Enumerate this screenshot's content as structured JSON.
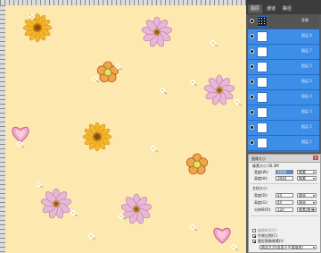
{
  "panel": {
    "tabs": [
      "图层",
      "通道",
      "路径"
    ],
    "layers": [
      {
        "name": "背景",
        "type": "background"
      },
      {
        "name": "图层 8"
      },
      {
        "name": "图层 7"
      },
      {
        "name": "图层 6"
      },
      {
        "name": "图层 5"
      },
      {
        "name": "图层 4"
      },
      {
        "name": "图层 3"
      },
      {
        "name": "图层 2"
      },
      {
        "name": "图层 1"
      }
    ]
  },
  "dialog": {
    "title": "图像大小",
    "pixel_dims_label": "像素大小:56.3M",
    "width_label": "宽度(W):",
    "width_value": "5000",
    "width_unit": "像素",
    "height_label": "高度(H):",
    "height_value": "3940",
    "height_unit": "像素",
    "doc_size_label": "文档大小:",
    "doc_width_label": "宽度(D):",
    "doc_width_value": "44",
    "doc_width_unit": "厘米",
    "doc_height_label": "高度(G):",
    "doc_height_value": "44",
    "doc_height_unit": "厘米",
    "resolution_label": "分辨率(R):",
    "resolution_value": "120",
    "resolution_unit": "像素/厘米",
    "scale_styles_label": "缩放样式(Y)",
    "constrain_label": "约束比例(C)",
    "resample_label": "重定图像像素(I):",
    "resample_method": "两次立方(适用于平滑渐变)"
  },
  "colors": {
    "canvas_bg": "#fde8b0",
    "layer_selected": "#3d8ee8"
  }
}
